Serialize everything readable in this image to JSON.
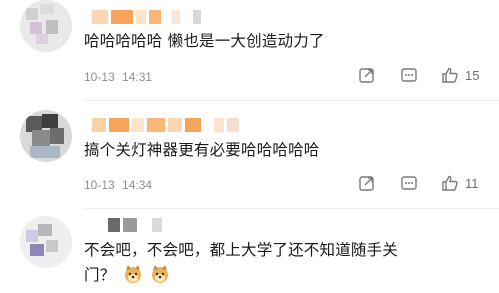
{
  "comments": [
    {
      "text": "哈哈哈哈哈 懒也是一大创造动力了",
      "date": "10-13",
      "time": "14:31",
      "like_count": "15"
    },
    {
      "text": "搞个关灯神器更有必要哈哈哈哈哈",
      "date": "10-13",
      "time": "14:34",
      "like_count": "11"
    },
    {
      "text_line1": "不会吧，不会吧，都上大学了还不知道随手关",
      "text_line2": "门？"
    }
  ],
  "icons": {
    "share": "share-icon",
    "comment": "comment-icon",
    "like": "thumbs-up-icon",
    "emoji": "doge-emoji"
  },
  "colors": {
    "text": "#1a1a1a",
    "meta": "#8f8f8f",
    "icon": "#7a7a7a",
    "name_blur_orange": "#f6a45a"
  }
}
